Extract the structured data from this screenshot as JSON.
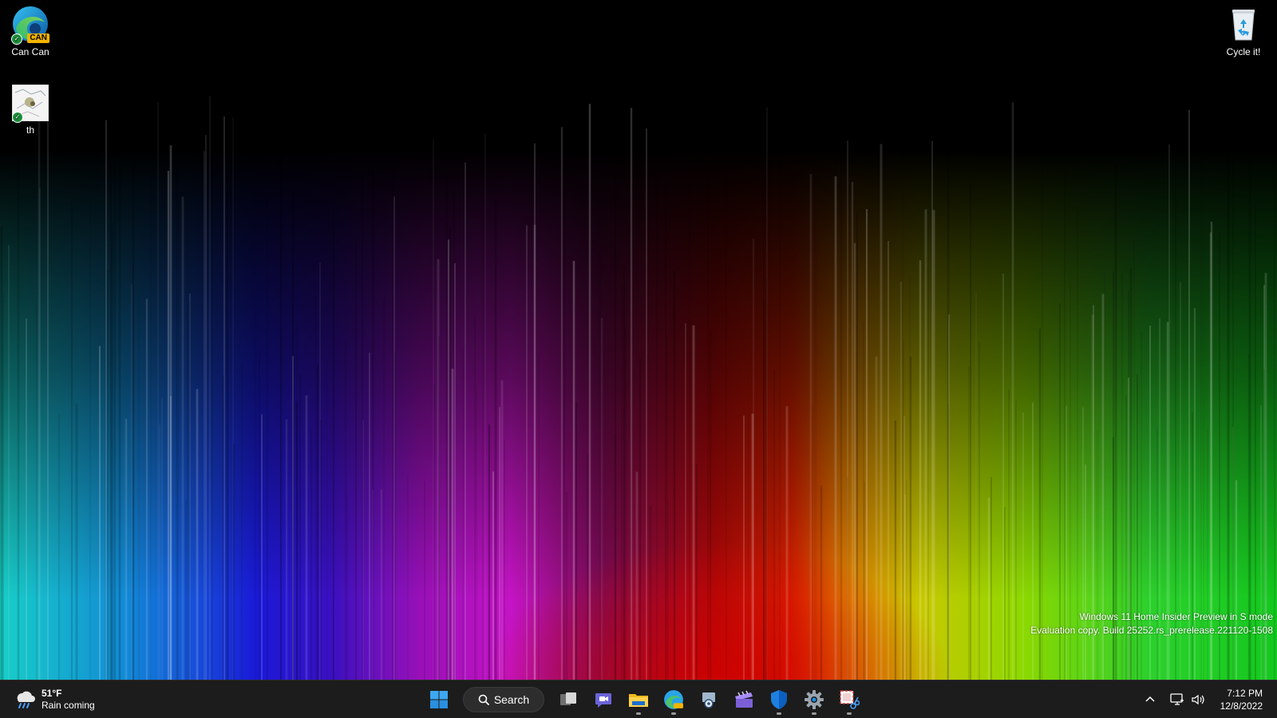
{
  "desktop": {
    "icons": [
      {
        "label": "Can Can",
        "badge": "CAN"
      },
      {
        "label": "th"
      },
      {
        "label": "Cycle it!"
      }
    ],
    "watermark": {
      "line1": "Windows 11 Home Insider Preview in S mode",
      "line2": "Evaluation copy. Build 25252.rs_prerelease.221120-1508"
    }
  },
  "taskbar": {
    "weather": {
      "temp": "51°F",
      "condition": "Rain coming",
      "icon": "rain-cloud-icon"
    },
    "search_label": "Search",
    "pinned": [
      {
        "name": "start-button",
        "icon": "windows-logo-icon"
      },
      {
        "name": "task-view-button",
        "icon": "task-view-icon"
      },
      {
        "name": "chat-button",
        "icon": "teams-chat-icon"
      },
      {
        "name": "file-explorer-button",
        "icon": "folder-icon",
        "running": true
      },
      {
        "name": "edge-canary-button",
        "icon": "edge-canary-icon",
        "running": true
      },
      {
        "name": "app-button",
        "icon": "app-gear-icon"
      },
      {
        "name": "clipchamp-button",
        "icon": "clipchamp-icon"
      },
      {
        "name": "defender-button",
        "icon": "shield-icon",
        "running": true
      },
      {
        "name": "settings-button",
        "icon": "gear-icon",
        "running": true
      },
      {
        "name": "snipping-tool-button",
        "icon": "snipping-icon",
        "running": true
      }
    ],
    "tray": {
      "time": "7:12 PM",
      "date": "12/8/2022"
    }
  },
  "colors": {
    "taskbar_bg": "#1c1c1c",
    "accent": "#0078d4",
    "can_badge": "#f4b400"
  }
}
